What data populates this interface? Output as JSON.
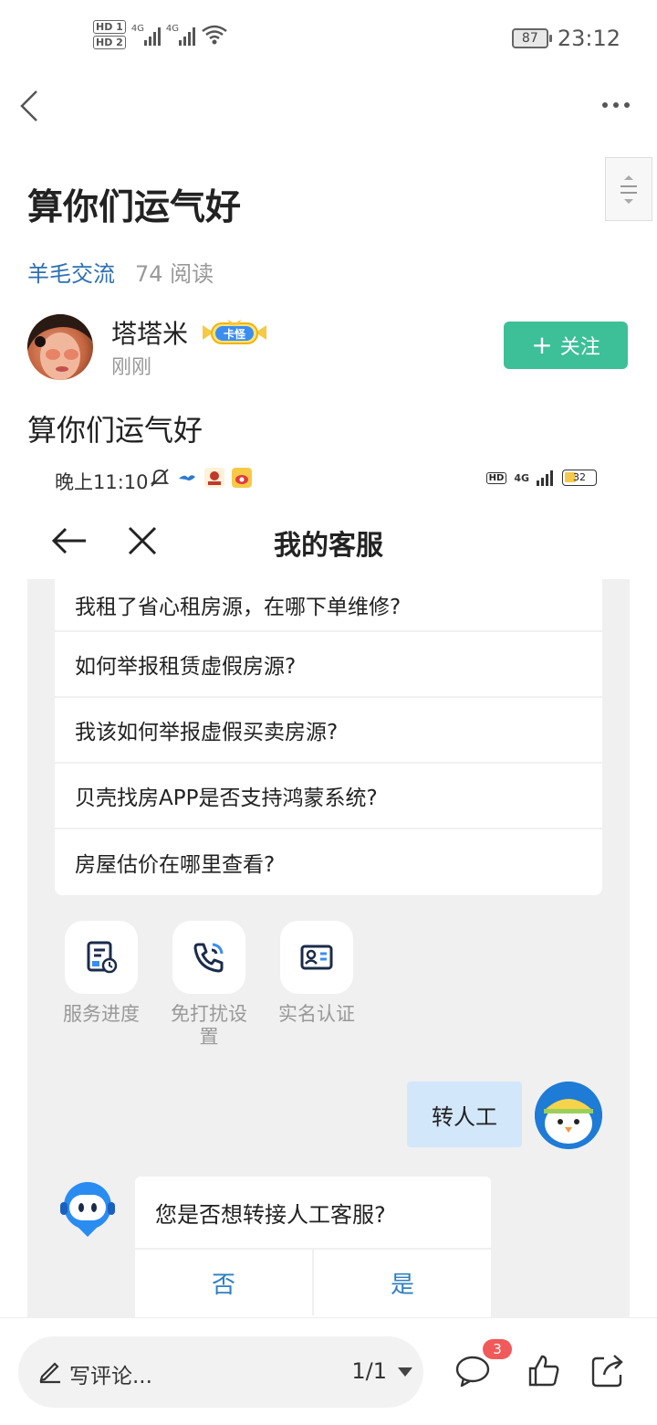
{
  "status_bar": {
    "hd1": "HD 1",
    "hd2": "HD 2",
    "net1": "4G",
    "net2": "4G",
    "battery": "87",
    "time": "23:12"
  },
  "post": {
    "title": "算你们运气好",
    "category": "羊毛交流",
    "reads": "74 阅读",
    "author": {
      "name": "塔塔米",
      "badge": "卡怪",
      "time": "刚刚",
      "follow_label": "关注"
    },
    "body": "算你们运气好"
  },
  "embedded": {
    "status": {
      "time": "晚上11:10",
      "hd": "HD",
      "net": "4G",
      "battery": "32"
    },
    "nav_title": "我的客服",
    "faq": [
      "我租了省心租房源，在哪下单维修?",
      "如何举报租赁虚假房源?",
      "我该如何举报虚假买卖房源?",
      "贝壳找房APP是否支持鸿蒙系统?",
      "房屋估价在哪里查看?"
    ],
    "tools": [
      {
        "label": "服务进度",
        "icon": "document-clock-icon"
      },
      {
        "label": "免打扰设置",
        "icon": "phone-call-icon"
      },
      {
        "label": "实名认证",
        "icon": "id-card-icon"
      }
    ],
    "user_message": "转人工",
    "bot_question": "您是否想转接人工客服?",
    "bot_option_no": "否",
    "bot_option_yes": "是"
  },
  "bottom_bar": {
    "comment_placeholder": "写评论...",
    "pager": "1/1",
    "comment_count": "3"
  },
  "colors": {
    "accent_green": "#3dbf98",
    "link_blue": "#2f6fb2",
    "bubble_blue": "#d3e7fb",
    "badge_red": "#f05a5a"
  }
}
